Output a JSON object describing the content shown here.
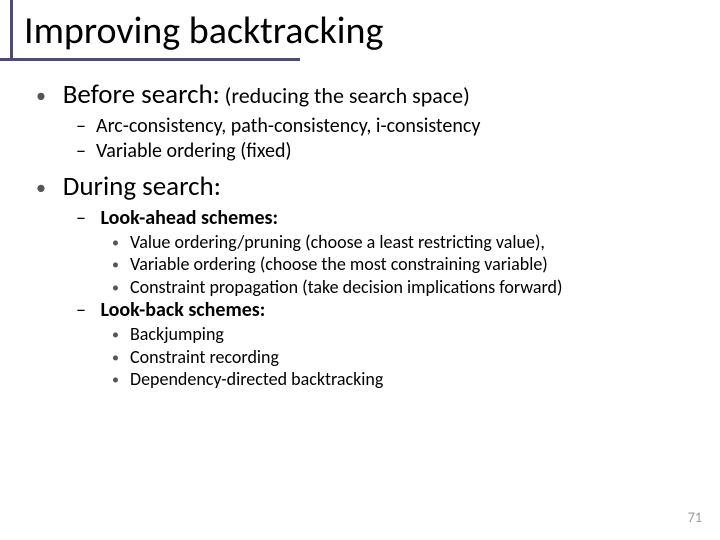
{
  "title": "Improving backtracking",
  "sections": [
    {
      "head": "Before search:",
      "note": "(reducing the search space)",
      "items": [
        {
          "text": "Arc-consistency, path-consistency, i-consistency"
        },
        {
          "text": "Variable ordering (fixed)"
        }
      ]
    },
    {
      "head": "During search:",
      "note": "",
      "items": [
        {
          "bold": "Look-ahead schemes:",
          "sub": [
            {
              "t": "Value ordering/pruning",
              "paren": "(choose a least restricting value)",
              "comma": true
            },
            {
              "t": "Variable ordering",
              "paren": "(choose the most constraining variable)"
            },
            {
              "t": "Constraint propagation",
              "paren": "(take decision implications forward)"
            }
          ]
        },
        {
          "bold": "Look-back schemes:",
          "sub": [
            {
              "t": "Backjumping"
            },
            {
              "t": "Constraint recording"
            },
            {
              "t": "Dependency-directed backtracking"
            }
          ]
        }
      ]
    }
  ],
  "page_number": "71"
}
